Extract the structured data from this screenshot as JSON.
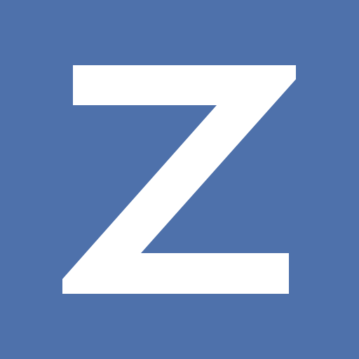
{
  "logo": {
    "letter": "Z",
    "background_color": "#4e71ab",
    "glyph_color": "#ffffff"
  }
}
